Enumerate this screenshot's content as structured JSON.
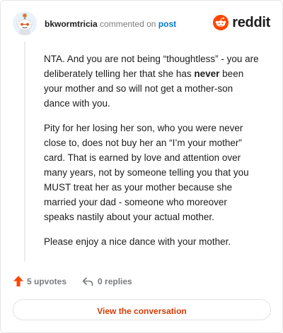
{
  "header": {
    "username": "bkwormtricia",
    "action_text": "commented on",
    "post_link": "post",
    "brand": "reddit"
  },
  "comment": {
    "p1_before": "NTA. And you are not being “thoughtless” - you are deliberately telling her that she has ",
    "p1_bold": "never",
    "p1_after": " been your mother and so will not get a mother-son dance with you.",
    "p2": "Pity for her losing her son, who you were never close to, does not buy her an “I’m your mother” card. That is earned by love and attention over many years, not by someone telling you that you MUST treat her as your mother because she married your dad - someone who moreover speaks nastily about your actual mother.",
    "p3": "Please enjoy a nice dance with your mother."
  },
  "actions": {
    "upvotes": "5 upvotes",
    "replies": "0 replies"
  },
  "footer": {
    "view_button": "View the conversation"
  },
  "colors": {
    "brand_orange": "#ff4500",
    "link_blue": "#0079d3",
    "button_text": "#d93a00"
  },
  "icons": {
    "avatar": "snoo-avatar-icon",
    "brand": "reddit-logo-icon",
    "upvote": "upvote-arrow-icon",
    "reply": "reply-arrow-icon"
  }
}
